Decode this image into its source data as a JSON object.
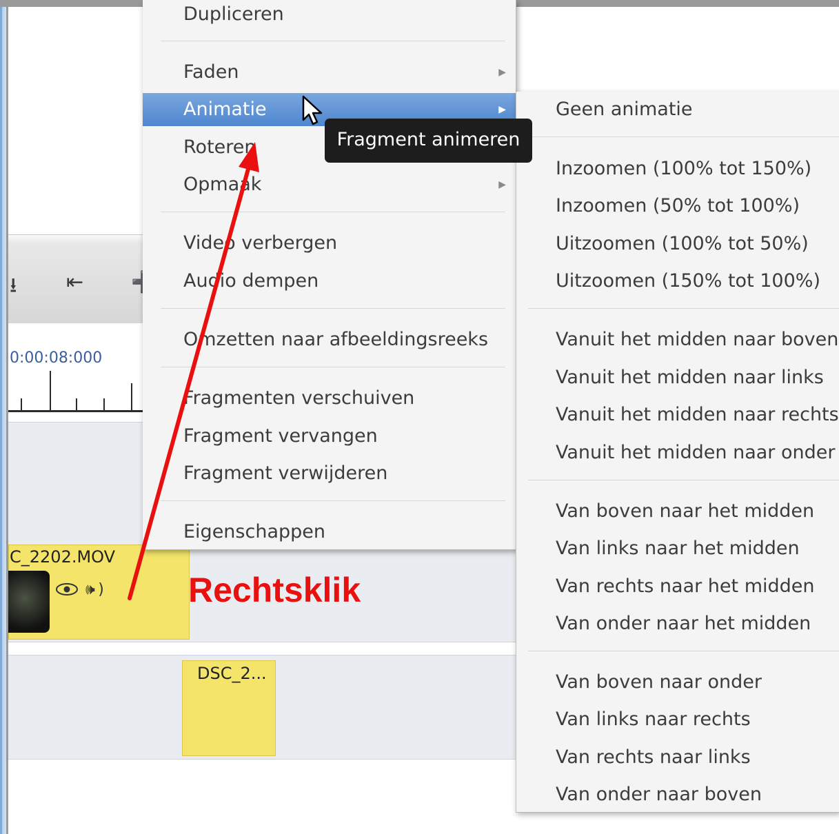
{
  "timeline": {
    "timecode": "0:00:08:000",
    "toolbar_icons": [
      "import-icon",
      "jump-to-start-icon",
      "split-icon"
    ]
  },
  "clips": {
    "clip1_name": "C_2202.MOV",
    "clip2_name": "DSC_2..."
  },
  "context_menu": {
    "items": [
      {
        "label": "Dupliceren",
        "submenu": false
      },
      {
        "label": "Faden",
        "submenu": true
      },
      {
        "label": "Animatie",
        "submenu": true,
        "active": true
      },
      {
        "label": "Roteren",
        "submenu": false
      },
      {
        "label": "Opmaak",
        "submenu": true
      },
      {
        "label": "Video verbergen",
        "submenu": false
      },
      {
        "label": "Audio dempen",
        "submenu": false
      },
      {
        "label": "Omzetten naar afbeeldingsreeks",
        "submenu": false
      },
      {
        "label": "Fragmenten verschuiven",
        "submenu": false
      },
      {
        "label": "Fragment vervangen",
        "submenu": false
      },
      {
        "label": "Fragment verwijderen",
        "submenu": false
      },
      {
        "label": "Eigenschappen",
        "submenu": false
      }
    ]
  },
  "tooltip": "Fragment animeren",
  "animation_submenu": {
    "items": [
      "Geen animatie",
      "Inzoomen (100% tot 150%)",
      "Inzoomen (50% tot 100%)",
      "Uitzoomen (100% tot 50%)",
      "Uitzoomen (150% tot 100%)",
      "Vanuit het midden naar boven",
      "Vanuit het midden naar links",
      "Vanuit het midden naar rechts",
      "Vanuit het midden naar onder",
      "Van boven naar het midden",
      "Van links naar het midden",
      "Van rechts naar het midden",
      "Van onder naar het midden",
      "Van boven naar onder",
      "Van links naar rechts",
      "Van rechts naar links",
      "Van onder naar boven"
    ]
  },
  "annotation": {
    "text": "Rechtsklik",
    "color": "#ea1010"
  },
  "colors": {
    "menu_highlight": "#4f86cf",
    "clip_fill": "#f4e56a",
    "tooltip_bg": "#1d1d1d"
  }
}
